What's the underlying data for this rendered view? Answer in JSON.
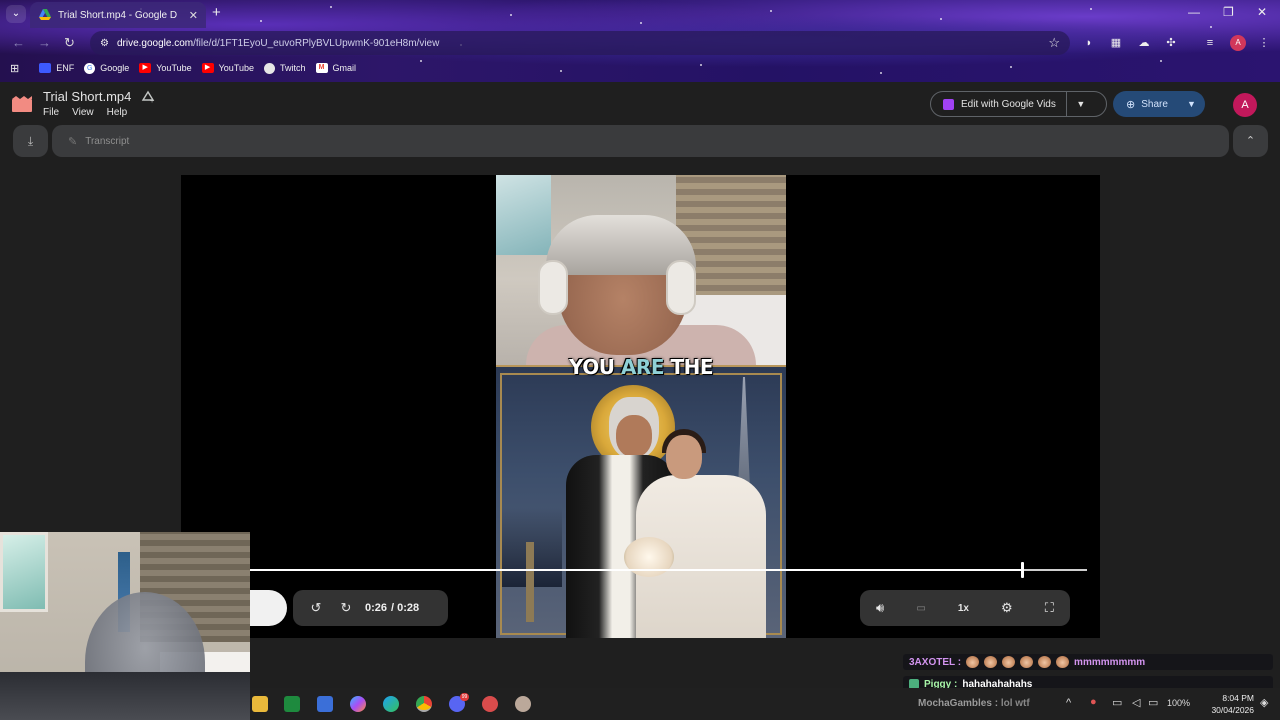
{
  "browser": {
    "tab_title": "Trial Short.mp4 - Google D",
    "url_domain": "drive.google.com",
    "url_path": "/file/d/1FT1EyoU_euvoRPlyBVLUpwmK-901eH8m/view",
    "profile_initial": "A",
    "bookmarks": [
      {
        "label": "ENF",
        "icon": "enf-icon",
        "color": "#3d5afe"
      },
      {
        "label": "Google",
        "icon": "google-icon",
        "color": "#ffffff"
      },
      {
        "label": "YouTube",
        "icon": "youtube-icon",
        "color": "#ff0000"
      },
      {
        "label": "YouTube",
        "icon": "youtube-icon",
        "color": "#ff0000"
      },
      {
        "label": "Twitch",
        "icon": "twitch-icon",
        "color": "#e6e6e6"
      },
      {
        "label": "Gmail",
        "icon": "gmail-icon",
        "color": "#ea4335"
      }
    ]
  },
  "drive": {
    "file_title": "Trial Short.mp4",
    "menus": [
      "File",
      "View",
      "Help"
    ],
    "vids_button": "Edit with Google Vids",
    "share_button": "Share",
    "avatar_initial": "A",
    "transcript_label": "Transcript",
    "accent": "#254a77"
  },
  "video": {
    "caption_parts": [
      "YOU ",
      "ARE",
      " THE"
    ],
    "caption_highlight_color": "#8fd0d6",
    "current_time": "0:26",
    "duration": "/ 0:28",
    "progress_fraction": 0.9286,
    "speed": "1x",
    "skip_back_seconds": "10",
    "skip_forward_seconds": "10"
  },
  "chat": [
    {
      "user": "3AXOTEL :",
      "message": "mmmmmmmm",
      "emotes": 6
    },
    {
      "user": "Piggy :",
      "message": "hahahahahahs"
    }
  ],
  "taskbar": {
    "notification_user": "MochaGambles :",
    "notification_message": "lol wtf",
    "battery": "100%",
    "time": "8:04 PM",
    "date": "30/04/2026",
    "discord_badge": "99"
  }
}
